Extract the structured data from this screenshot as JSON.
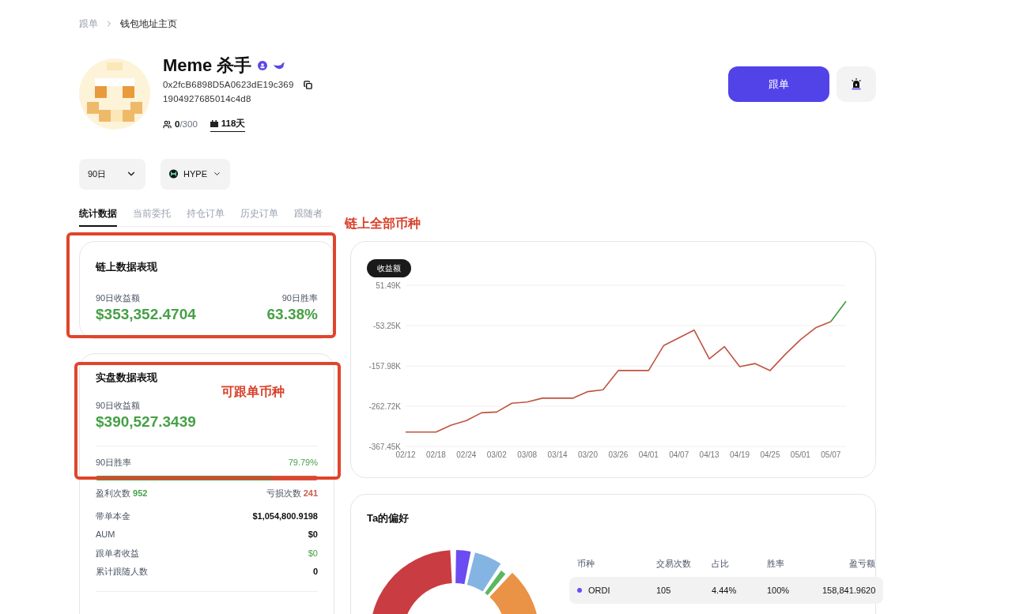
{
  "breadcrumb": [
    {
      "label": "跟单"
    },
    {
      "label": "钱包地址主页"
    }
  ],
  "profile": {
    "name": "Meme 杀手",
    "address_line_1": "0x2fcB6898D5A0623dE19c369",
    "address_line_2": "1904927685014c4d8",
    "followers": "0",
    "followers_max": "/300",
    "days": "118天"
  },
  "actions": {
    "follow_button": "跟单"
  },
  "filters": [
    {
      "label": "90日",
      "kind": "period"
    },
    {
      "label": "HYPE",
      "kind": "coin"
    }
  ],
  "tabs": [
    {
      "label": "统计数据",
      "selected": true
    },
    {
      "label": "当前委托",
      "selected": false
    },
    {
      "label": "持仓订单",
      "selected": false
    },
    {
      "label": "历史订单",
      "selected": false
    },
    {
      "label": "跟随者",
      "selected": false
    }
  ],
  "onchain_card": {
    "title": "链上数据表现",
    "profit_label": "90日收益额",
    "profit": "$353,352.4704",
    "winrate_label": "90日胜率",
    "winrate": "63.38%"
  },
  "live_card": {
    "title": "实盘数据表现",
    "profit_label": "90日收益额",
    "profit": "$390,527.3439",
    "winrate_label": "90日胜率",
    "winrate": "79.79%",
    "level": 0.7979,
    "wins_label": "盈利次数",
    "wins": "952",
    "losses_label": "亏损次数",
    "losses": "241",
    "stats": [
      {
        "label": "带单本金",
        "value": "$1,054,800.9198",
        "kind": "plain"
      },
      {
        "label": "AUM",
        "value": "$0",
        "kind": "plain"
      },
      {
        "label": "跟单者收益",
        "value": "$0",
        "kind": "profit"
      },
      {
        "label": "累计跟随人数",
        "value": "0",
        "kind": "plain"
      }
    ]
  },
  "chart_card": {
    "tag": "收益额",
    "chart_data": {
      "type": "line",
      "x": [
        "02/12",
        null,
        "02/18",
        null,
        "02/24",
        null,
        "03/02",
        null,
        "03/08",
        null,
        "03/14",
        null,
        "03/20",
        null,
        "03/26",
        null,
        "04/01",
        null,
        "04/07",
        null,
        "04/13",
        null,
        "04/19",
        null,
        "04/25",
        null,
        "05/01",
        null,
        "05/07",
        null
      ],
      "series": [
        {
          "color": "#c0533f",
          "values": [
            -330,
            -330,
            -330,
            -312,
            -300,
            -280,
            -278,
            -255,
            -252,
            -242,
            -242,
            -242,
            -225,
            -220,
            -170,
            -170,
            -170,
            -105,
            -85,
            -65,
            -140,
            -108,
            -160,
            -152,
            -170,
            -128,
            -90,
            -59,
            -43,
            null
          ]
        },
        {
          "color": "#3f9a3f",
          "values": [
            null,
            null,
            null,
            null,
            null,
            null,
            null,
            null,
            null,
            null,
            null,
            null,
            null,
            null,
            null,
            null,
            null,
            null,
            null,
            null,
            null,
            null,
            null,
            null,
            null,
            null,
            null,
            null,
            -43,
            10
          ]
        }
      ],
      "ylim": [
        -367.45,
        51.49
      ],
      "yticks": [
        {
          "value": 51.49,
          "label": "51.49K"
        },
        {
          "value": -53.25,
          "label": "-53.25K"
        },
        {
          "value": -157.98,
          "label": "-157.98K"
        },
        {
          "value": -262.72,
          "label": "-262.72K"
        },
        {
          "value": -367.45,
          "label": "-367.45K"
        }
      ],
      "grid": true
    }
  },
  "preference_card": {
    "title": "Ta的偏好",
    "columns": [
      "币种",
      "交易次数",
      "占比",
      "胜率",
      "盈亏额"
    ],
    "rows": [
      {
        "coin": "ORDI",
        "color": "#6b4ef0",
        "trades": "105",
        "share": "4.44%",
        "winrate": "100%",
        "pnl": "158,841.9620"
      }
    ]
  },
  "annotations": [
    {
      "label": "链上全部币种"
    },
    {
      "label": "可跟单币种"
    }
  ]
}
